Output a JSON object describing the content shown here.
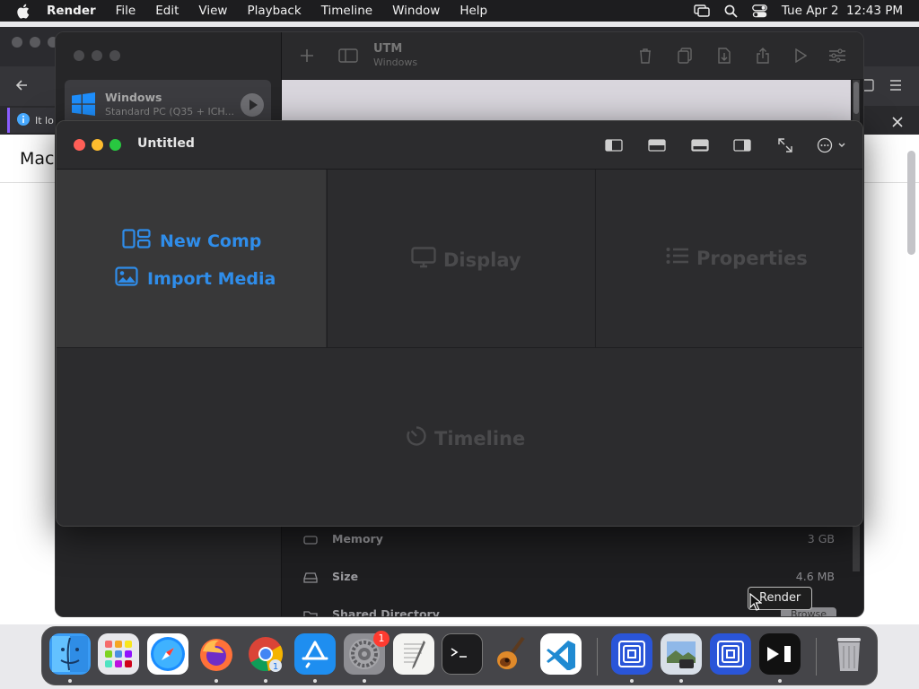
{
  "menubar": {
    "app": "Render",
    "items": [
      "File",
      "Edit",
      "View",
      "Playback",
      "Timeline",
      "Window",
      "Help"
    ],
    "datetime": "Tue Apr 2  12:43 PM"
  },
  "browser": {
    "info_text": "It lo",
    "page_heading": "Mac"
  },
  "utm": {
    "title": "UTM",
    "subtitle": "Windows",
    "vm": {
      "name": "Windows",
      "subtitle": "Standard PC (Q35 + ICH..."
    },
    "details": [
      {
        "label": "Memory",
        "value": "3 GB",
        "icon": "memory-icon"
      },
      {
        "label": "Size",
        "value": "4.6 MB",
        "icon": "drive-icon"
      },
      {
        "label": "Shared Directory",
        "value": "",
        "icon": "folder-icon"
      }
    ],
    "browse_label": "Browse"
  },
  "render": {
    "title": "Untitled",
    "new_comp": "New Comp",
    "import_media": "Import Media",
    "display": "Display",
    "properties": "Properties",
    "timeline": "Timeline",
    "accent_color": "#2f8dea"
  },
  "tooltip": "Render",
  "dock": {
    "apps": [
      "Finder",
      "Launchpad",
      "Safari",
      "Firefox",
      "Chrome",
      "App Store",
      "System Settings",
      "TextEdit",
      "Terminal",
      "GarageBand",
      "Visual Studio Code",
      "UTM",
      "Preview",
      "UTM",
      "CapCut",
      "Trash"
    ],
    "settings_badge": "1",
    "chrome_badge": "1"
  }
}
